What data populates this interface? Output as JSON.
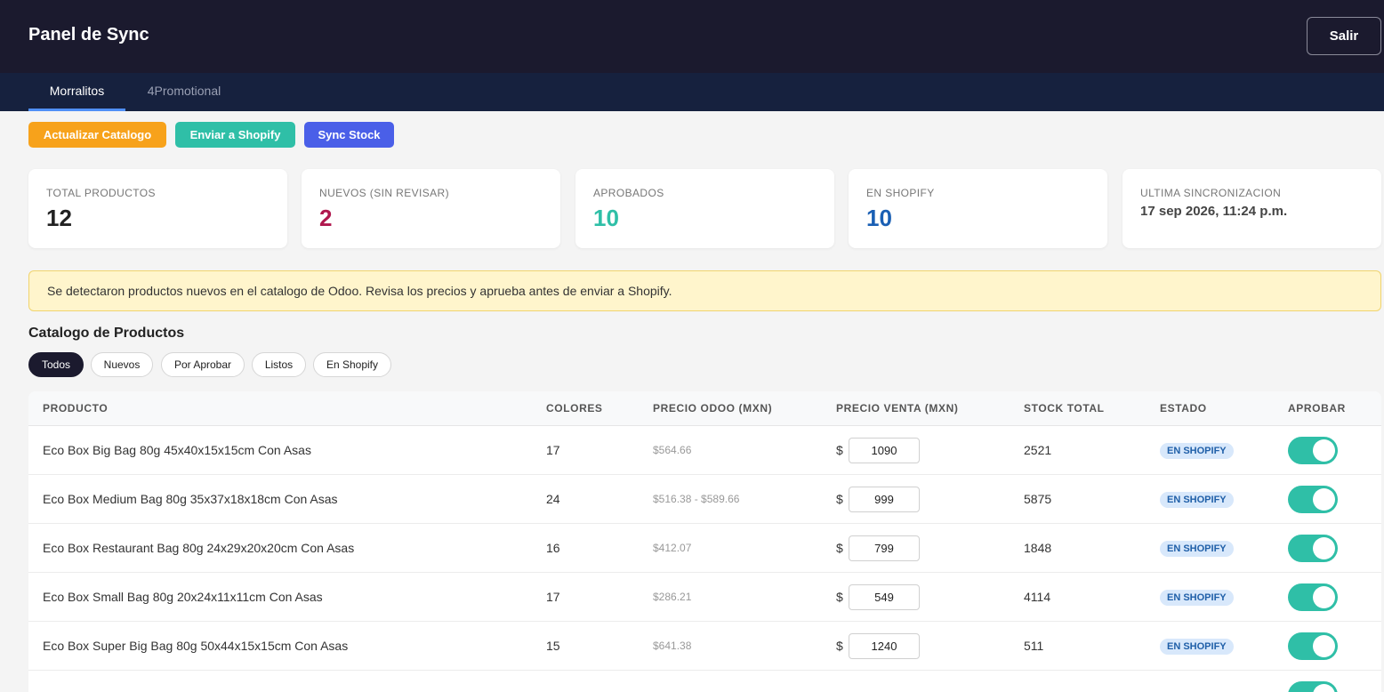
{
  "header": {
    "title": "Panel de Sync",
    "logout_label": "Salir"
  },
  "tabs": [
    {
      "label": "Morralitos",
      "active": true
    },
    {
      "label": "4Promotional",
      "active": false
    }
  ],
  "actions": {
    "update_catalog": "Actualizar Catalogo",
    "send_shopify": "Enviar a Shopify",
    "sync_stock": "Sync Stock"
  },
  "stats": {
    "total_label": "TOTAL PRODUCTOS",
    "total_value": "12",
    "new_label": "NUEVOS (SIN REVISAR)",
    "new_value": "2",
    "approved_label": "APROBADOS",
    "approved_value": "10",
    "shopify_label": "EN SHOPIFY",
    "shopify_value": "10",
    "lastsync_label": "ULTIMA SINCRONIZACION",
    "lastsync_value": "17 sep 2026, 11:24 p.m."
  },
  "alert": {
    "message": "Se detectaron productos nuevos en el catalogo de Odoo. Revisa los precios y aprueba antes de enviar a Shopify."
  },
  "catalog": {
    "title": "Catalogo de Productos",
    "filters": [
      "Todos",
      "Nuevos",
      "Por Aprobar",
      "Listos",
      "En Shopify"
    ],
    "active_filter": "Todos",
    "columns": {
      "product": "PRODUCTO",
      "colors": "COLORES",
      "odoo_price": "PRECIO ODOO (MXN)",
      "sale_price": "PRECIO VENTA (MXN)",
      "stock": "STOCK TOTAL",
      "status": "ESTADO",
      "approve": "APROBAR"
    },
    "currency_symbol": "$",
    "rows": [
      {
        "name": "Eco Box Big Bag 80g 45x40x15x15cm Con Asas",
        "colors": "17",
        "odoo_price": "$564.66",
        "sale_price": "1090",
        "stock": "2521",
        "status": "EN SHOPIFY",
        "approved": true
      },
      {
        "name": "Eco Box Medium Bag 80g 35x37x18x18cm Con Asas",
        "colors": "24",
        "odoo_price": "$516.38 - $589.66",
        "sale_price": "999",
        "stock": "5875",
        "status": "EN SHOPIFY",
        "approved": true
      },
      {
        "name": "Eco Box Restaurant Bag 80g 24x29x20x20cm Con Asas",
        "colors": "16",
        "odoo_price": "$412.07",
        "sale_price": "799",
        "stock": "1848",
        "status": "EN SHOPIFY",
        "approved": true
      },
      {
        "name": "Eco Box Small Bag 80g 20x24x11x11cm Con Asas",
        "colors": "17",
        "odoo_price": "$286.21",
        "sale_price": "549",
        "stock": "4114",
        "status": "EN SHOPIFY",
        "approved": true
      },
      {
        "name": "Eco Box Super Big Bag 80g 50x44x15x15cm Con Asas",
        "colors": "15",
        "odoo_price": "$641.38",
        "sale_price": "1240",
        "stock": "511",
        "status": "EN SHOPIFY",
        "approved": true
      }
    ]
  },
  "colors": {
    "header_bg": "#1b1a2e",
    "tabbar_bg": "#16213e",
    "btn_update": "#f7a21b",
    "btn_send": "#2fbfa7",
    "btn_sync": "#4a5fe8",
    "stat_total": "#222222",
    "stat_new": "#b0184e",
    "stat_approved": "#2fbfa7",
    "stat_shopify": "#1a5fb4"
  }
}
